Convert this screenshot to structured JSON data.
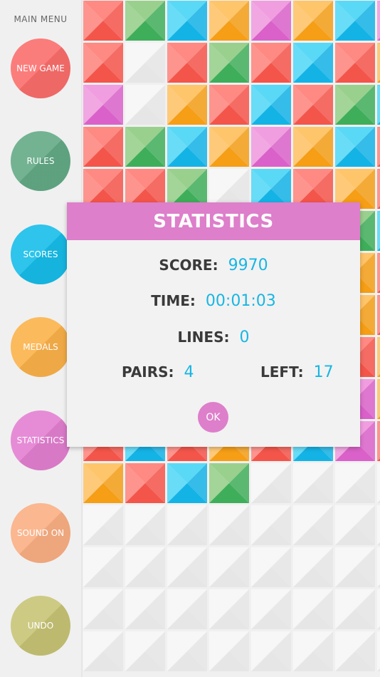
{
  "sidebar": {
    "title": "MAIN MENU",
    "items": [
      {
        "key": "new-game",
        "label": "NEW GAME",
        "color": "#fb6e6c"
      },
      {
        "key": "rules",
        "label": "RULES",
        "color": "#63aa86"
      },
      {
        "key": "scores",
        "label": "SCORES",
        "color": "#16bde9"
      },
      {
        "key": "medals",
        "label": "MEDALS",
        "color": "#fbb24a"
      },
      {
        "key": "statistics",
        "label": "STATISTICS",
        "color": "#e37fd1"
      },
      {
        "key": "sound",
        "label": "SOUND ON",
        "color": "#fbaf84"
      },
      {
        "key": "undo",
        "label": "UNDO",
        "color": "#c7c476"
      }
    ]
  },
  "colors": {
    "R": [
      "#ff8a83",
      "#f4554a"
    ],
    "G": [
      "#9ad08e",
      "#3fae5a"
    ],
    "C": [
      "#5ad9f7",
      "#14b3e6"
    ],
    "O": [
      "#ffc56b",
      "#f59e16"
    ],
    "P": [
      "#f19ee0",
      "#da61c9"
    ],
    "E": [
      "#f7f7f7",
      "#e6e6e6"
    ]
  },
  "board": {
    "rows": [
      [
        "R",
        "G",
        "C",
        "O",
        "P",
        "O",
        "C",
        "P"
      ],
      [
        "R",
        "E",
        "R",
        "G",
        "R",
        "C",
        "R",
        "O"
      ],
      [
        "P",
        "E",
        "O",
        "R",
        "C",
        "R",
        "G",
        "C"
      ],
      [
        "R",
        "G",
        "C",
        "O",
        "P",
        "O",
        "C",
        "R"
      ],
      [
        "R",
        "R",
        "G",
        "E",
        "C",
        "R",
        "O",
        "R"
      ],
      [
        "O",
        "G",
        "R",
        "C",
        "R",
        "P",
        "G",
        "C"
      ],
      [
        "R",
        "C",
        "O",
        "R",
        "C",
        "R",
        "O",
        "R"
      ],
      [
        "O",
        "R",
        "G",
        "C",
        "R",
        "C",
        "O",
        "R"
      ],
      [
        "R",
        "C",
        "R",
        "O",
        "G",
        "C",
        "R",
        "O"
      ],
      [
        "P",
        "R",
        "O",
        "R",
        "C",
        "G",
        "P",
        "O"
      ],
      [
        "R",
        "C",
        "R",
        "O",
        "R",
        "C",
        "P",
        "R"
      ],
      [
        "O",
        "R",
        "C",
        "G",
        "E",
        "E",
        "E",
        "E"
      ],
      [
        "E",
        "E",
        "E",
        "E",
        "E",
        "E",
        "E",
        "E"
      ],
      [
        "E",
        "E",
        "E",
        "E",
        "E",
        "E",
        "E",
        "E"
      ],
      [
        "E",
        "E",
        "E",
        "E",
        "E",
        "E",
        "E",
        "E"
      ],
      [
        "E",
        "E",
        "E",
        "E",
        "E",
        "E",
        "E",
        "E"
      ]
    ]
  },
  "modal": {
    "title": "STATISTICS",
    "score_label": "SCORE:",
    "score_value": "9970",
    "time_label": "TIME:",
    "time_value": "00:01:03",
    "lines_label": "LINES:",
    "lines_value": "0",
    "pairs_label": "PAIRS:",
    "pairs_value": "4",
    "left_label": "LEFT:",
    "left_value": "17",
    "ok_label": "OK",
    "header_color": "#dd7fca",
    "value_color": "#18b6e3"
  }
}
